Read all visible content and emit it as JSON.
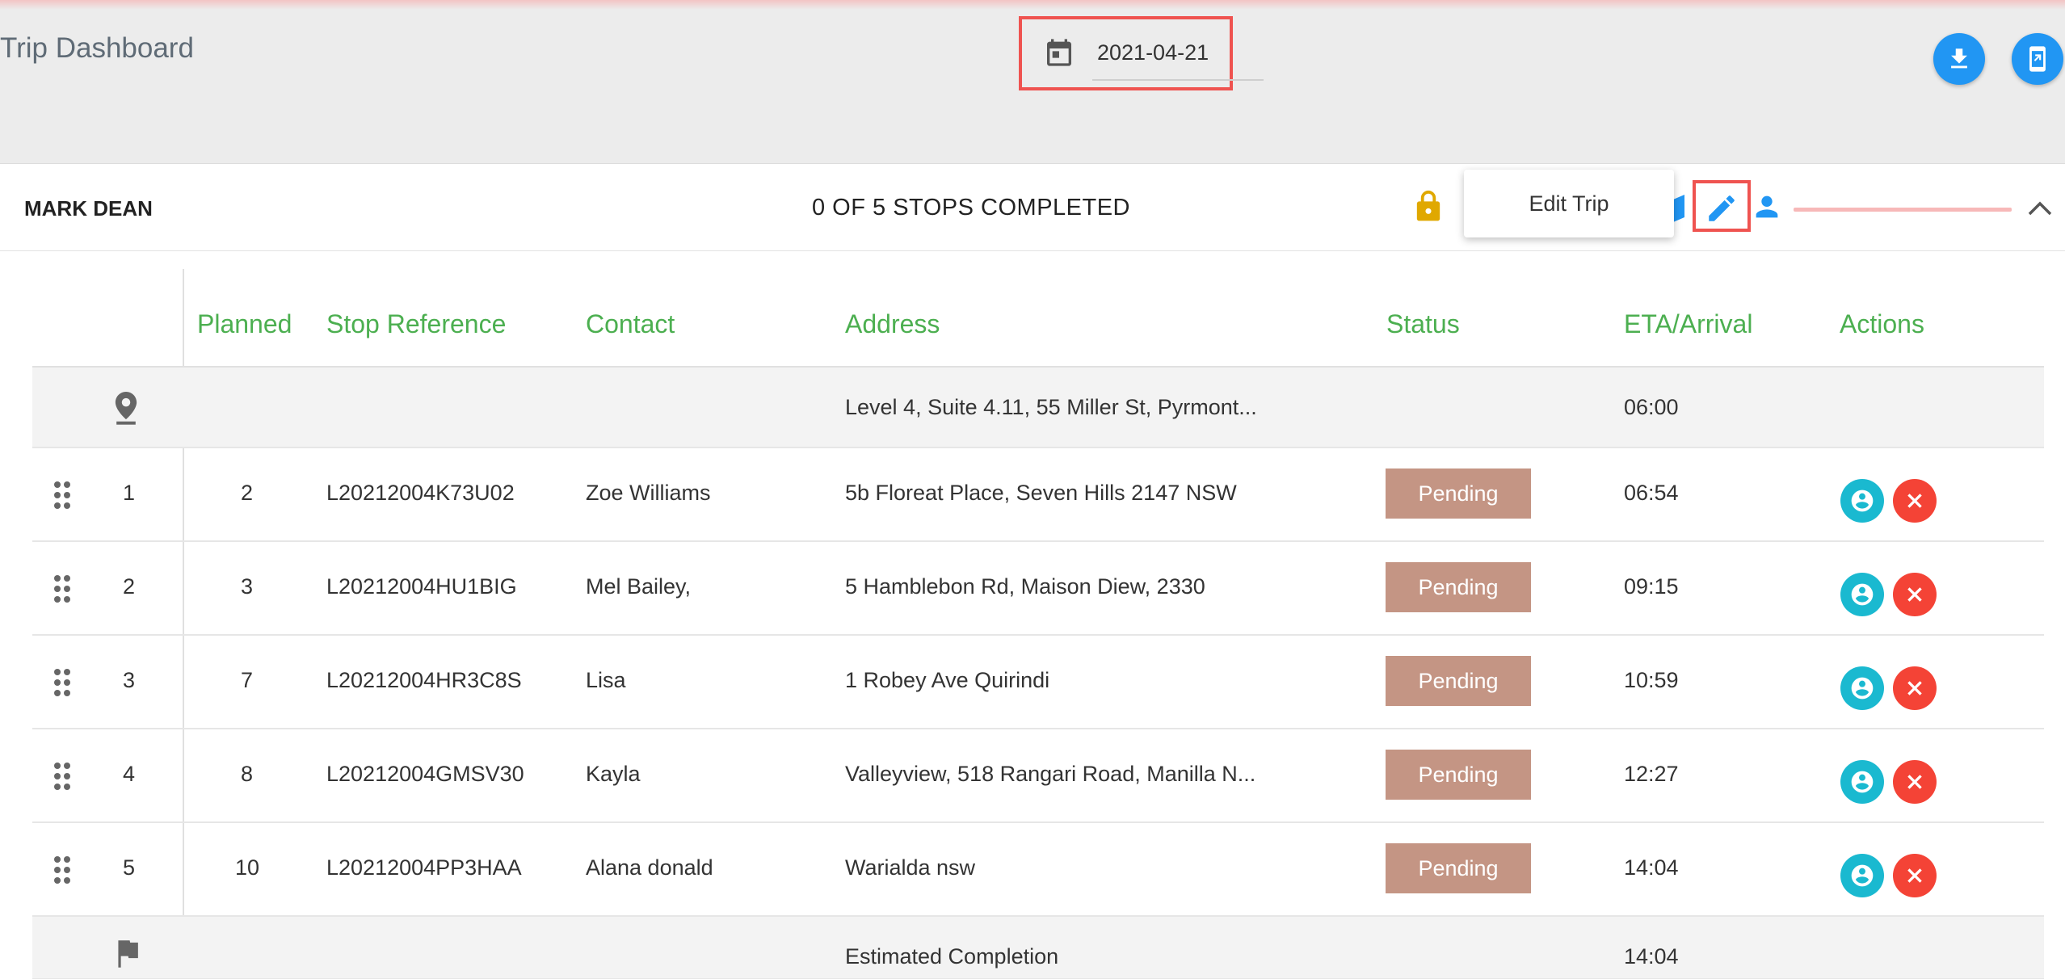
{
  "header": {
    "title": "Trip Dashboard",
    "date": "2021-04-21",
    "icons": {
      "date": "calendar-icon",
      "download": "download-icon",
      "mobile": "mobile-send-icon"
    }
  },
  "trip": {
    "driver": "MARK DEAN",
    "summary": "0 OF 5 STOPS COMPLETED",
    "tooltip": "Edit Trip",
    "colors": {
      "lock": "#e0a800",
      "accent": "#2196f3",
      "progress": "#f7b8b8",
      "highlight": "#ef5350"
    }
  },
  "table": {
    "columns": [
      "Planned",
      "Stop Reference",
      "Contact",
      "Address",
      "Status",
      "ETA/Arrival",
      "Actions"
    ],
    "start": {
      "address": "Level 4, Suite 4.11, 55 Miller St, Pyrmont...",
      "eta": "06:00"
    },
    "rows": [
      {
        "index": "1",
        "planned": "2",
        "reference": "L20212004K73U02",
        "contact": "Zoe Williams",
        "address": "5b Floreat Place, Seven Hills 2147 NSW",
        "status": "Pending",
        "eta": "06:54"
      },
      {
        "index": "2",
        "planned": "3",
        "reference": "L20212004HU1BIG",
        "contact": "Mel Bailey,",
        "address": "5 Hamblebon Rd, Maison Diew, 2330",
        "status": "Pending",
        "eta": "09:15"
      },
      {
        "index": "3",
        "planned": "7",
        "reference": "L20212004HR3C8S",
        "contact": "Lisa",
        "address": "1 Robey Ave Quirindi",
        "status": "Pending",
        "eta": "10:59"
      },
      {
        "index": "4",
        "planned": "8",
        "reference": "L20212004GMSV30",
        "contact": "Kayla",
        "address": "Valleyview, 518 Rangari Road, Manilla N...",
        "status": "Pending",
        "eta": "12:27"
      },
      {
        "index": "5",
        "planned": "10",
        "reference": "L20212004PP3HAA",
        "contact": "Alana donald",
        "address": "Warialda nsw",
        "status": "Pending",
        "eta": "14:04"
      }
    ],
    "end": {
      "label": "Estimated Completion",
      "eta": "14:04"
    },
    "colors": {
      "header_text": "#4caf50",
      "status_pending": "#c49584",
      "assign": "#1ab9d0",
      "remove": "#f44336"
    }
  }
}
